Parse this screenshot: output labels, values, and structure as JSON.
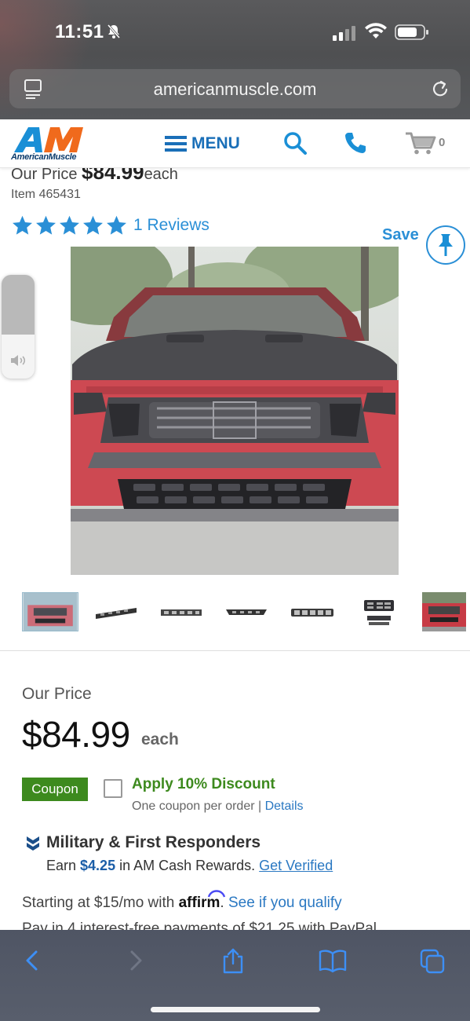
{
  "status_bar": {
    "time": "11:51",
    "icons": [
      "bell-slash-icon",
      "cellular-signal-icon",
      "wifi-icon",
      "battery-icon"
    ]
  },
  "browser": {
    "url": "americanmuscle.com",
    "icons": [
      "page-menu-icon",
      "reload-icon"
    ],
    "toolbar_icons": [
      "back-icon",
      "forward-icon",
      "share-icon",
      "bookmarks-icon",
      "tabs-icon"
    ]
  },
  "header": {
    "logo_text": "AM",
    "logo_subtitle": "AmericanMuscle",
    "menu_label": "MENU",
    "cart_count": "0",
    "icons": [
      "hamburger-icon",
      "search-icon",
      "phone-icon",
      "cart-icon"
    ]
  },
  "product": {
    "cut_price_prefix": "Our Price",
    "cut_price_value": "$84.99",
    "cut_price_suffix": "each",
    "item_number": "Item 465431",
    "rating": 5,
    "reviews_label": "1 Reviews",
    "save_label": "Save",
    "thumbnail_count": 7,
    "active_thumbnail": 1
  },
  "pricing": {
    "label": "Our Price",
    "value": "$84.99",
    "unit": "each"
  },
  "coupon": {
    "badge": "Coupon",
    "title": "Apply 10% Discount",
    "note": "One coupon per order | ",
    "details_link": "Details",
    "checked": false
  },
  "rewards": {
    "title": "Military & First Responders",
    "earn_prefix": "Earn ",
    "amount": "$4.25",
    "earn_suffix": " in AM Cash Rewards. ",
    "verify_link": "Get Verified"
  },
  "financing": {
    "prefix": "Starting at $15/mo with ",
    "brand": "affirm",
    "suffix": ". ",
    "link": "See if you qualify",
    "cut_line": "Pay in 4 interest-free payments of $21.25 with PayPal"
  },
  "colors": {
    "brand_blue": "#1a6fb8",
    "link_blue": "#2a8fd6",
    "coupon_green": "#3d8a1e",
    "star_blue": "#2a8fd6"
  }
}
